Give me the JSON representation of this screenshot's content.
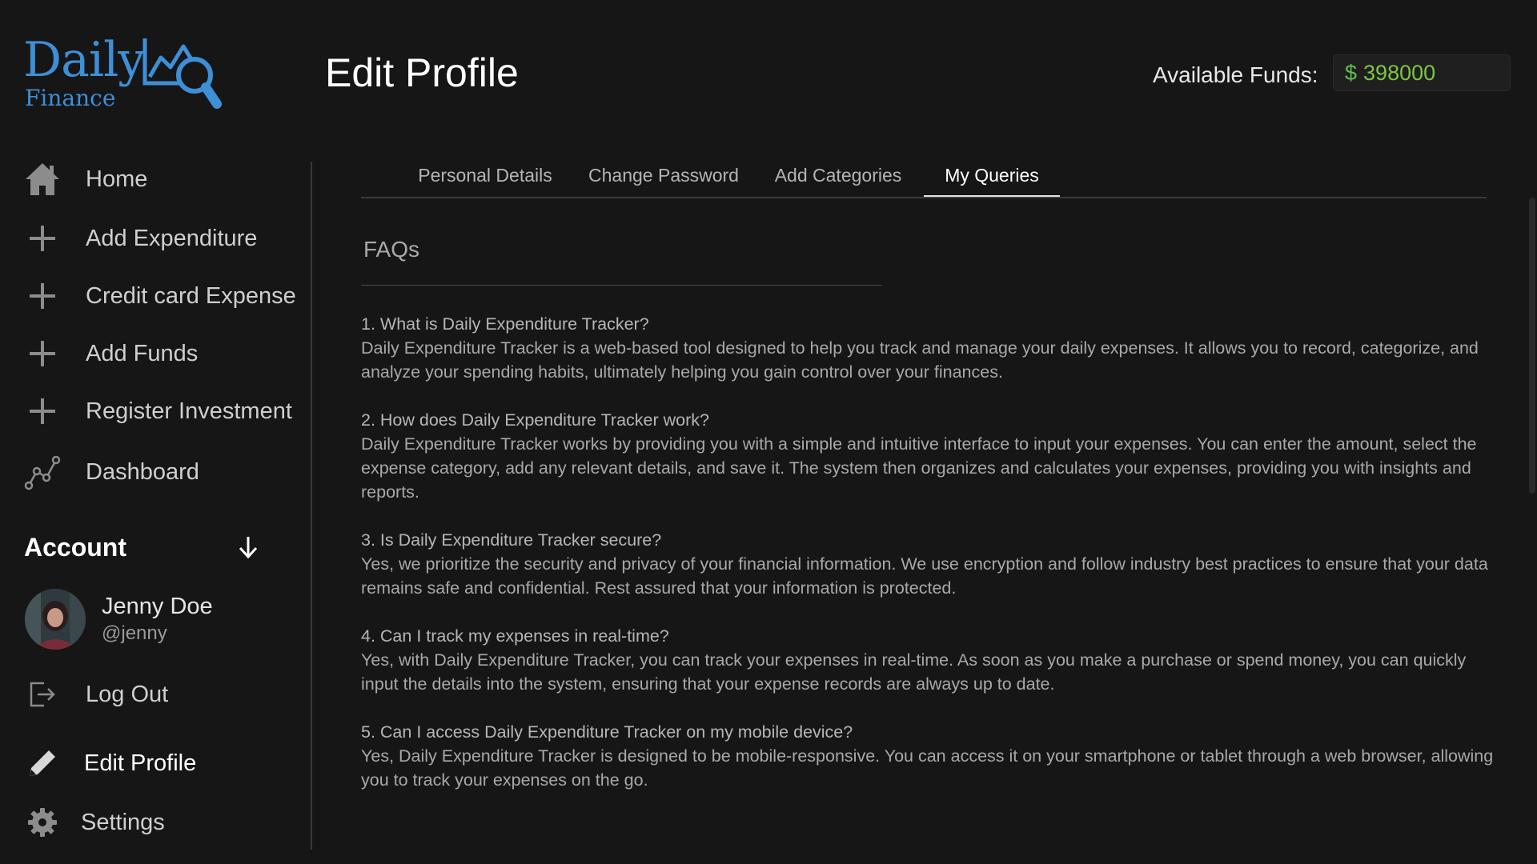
{
  "brand": {
    "name": "Daily",
    "sub": "Finance",
    "color": "#3d8fd6"
  },
  "header": {
    "title": "Edit Profile",
    "funds_label": "Available Funds:",
    "funds_currency": "$",
    "funds_value": "398000",
    "funds_color": "#7cc544"
  },
  "nav": {
    "items": [
      {
        "label": "Home",
        "icon": "home-icon"
      },
      {
        "label": "Add Expenditure",
        "icon": "plus-icon"
      },
      {
        "label": "Credit card Expense",
        "icon": "plus-icon"
      },
      {
        "label": "Add Funds",
        "icon": "plus-icon"
      },
      {
        "label": "Register Investment",
        "icon": "plus-icon"
      },
      {
        "label": "Dashboard",
        "icon": "chart-line-icon"
      }
    ],
    "account_label": "Account",
    "user": {
      "name": "Jenny Doe",
      "handle": "@jenny"
    },
    "logout": "Log Out",
    "edit_profile": "Edit Profile",
    "settings": "Settings"
  },
  "tabs": [
    {
      "label": "Personal Details"
    },
    {
      "label": "Change Password"
    },
    {
      "label": "Add Categories"
    },
    {
      "label": "My Queries",
      "active": true
    }
  ],
  "faq": {
    "title": "FAQs",
    "items": [
      {
        "q": "1. What is Daily Expenditure Tracker?",
        "a": "Daily Expenditure Tracker is a web-based tool designed to help you track and manage your daily expenses. It allows you to record, categorize, and analyze your spending habits, ultimately helping you gain control over your finances."
      },
      {
        "q": "2. How does Daily Expenditure Tracker work?",
        "a": "Daily Expenditure Tracker works by providing you with a simple and intuitive interface to input your expenses. You can enter the amount, select the expense category, add any relevant details, and save it. The system then organizes and calculates your expenses, providing you with insights and reports."
      },
      {
        "q": "3. Is Daily Expenditure Tracker secure?",
        "a": "Yes, we prioritize the security and privacy of your financial information. We use encryption and follow industry best practices to ensure that your data remains safe and confidential. Rest assured that your information is protected."
      },
      {
        "q": "4. Can I track my expenses in real-time?",
        "a": "Yes, with Daily Expenditure Tracker, you can track your expenses in real-time. As soon as you make a purchase or spend money, you can quickly input the details into the system, ensuring that your expense records are always up to date."
      },
      {
        "q": "5. Can I access Daily Expenditure Tracker on my mobile device?",
        "a": "Yes, Daily Expenditure Tracker is designed to be mobile-responsive. You can access it on your smartphone or tablet through a web browser, allowing you to track your expenses on the go."
      }
    ]
  }
}
